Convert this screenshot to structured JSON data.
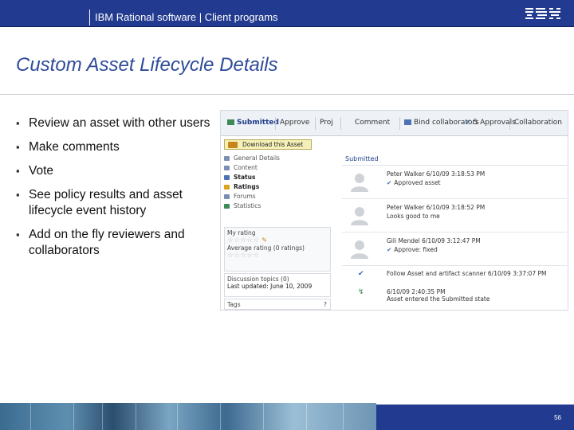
{
  "header": {
    "title": "IBM Rational software  |  Client programs",
    "logo_text": "IBM"
  },
  "page_title": "Custom Asset Lifecycle Details",
  "bullets": [
    "Review an asset with other users",
    "Make comments",
    "Vote",
    "See policy results and asset lifecycle event history",
    "Add on the fly reviewers and collaborators"
  ],
  "screenshot": {
    "tabs": [
      {
        "label": "Submitted",
        "active": true
      },
      {
        "label": "Approve",
        "active": false
      },
      {
        "label": "Proj",
        "active": false
      },
      {
        "label": "Comment",
        "active": false
      },
      {
        "label": "Bind collaborators",
        "active": false
      },
      {
        "label": "5 Approvals",
        "active": false
      },
      {
        "label": "Collaboration",
        "active": false
      }
    ],
    "download_label": "Download this Asset",
    "nav": [
      {
        "label": "General Details",
        "bold": false,
        "color": "#7b8fb5"
      },
      {
        "label": "Content",
        "bold": false,
        "color": "#7b8fb5"
      },
      {
        "label": "Status",
        "bold": true,
        "color": "#4a72b5"
      },
      {
        "label": "Ratings",
        "bold": true,
        "color": "#d9a21b"
      },
      {
        "label": "Forums",
        "bold": false,
        "color": "#7b8fb5"
      },
      {
        "label": "Statistics",
        "bold": false,
        "color": "#3d8a57"
      }
    ],
    "my_rating_label": "My rating",
    "my_rating_stars": "☆☆☆☆☆",
    "avg_rating_label": "Average rating (0 ratings)",
    "avg_rating_stars": "☆☆☆☆☆",
    "discussion_label": "Discussion topics (0)",
    "last_updated_label": "Last updated: June 10, 2009",
    "tags_label": "Tags",
    "tags_count": "?",
    "submitted_heading": "Submitted",
    "entries": [
      {
        "name_line": "Peter Walker 6/10/09 3:18:53 PM",
        "detail": "Approved asset",
        "checked": true
      },
      {
        "name_line": "Peter Walker 6/10/09 3:18:52 PM",
        "detail": "Looks good to me",
        "checked": false
      },
      {
        "name_line": "Gili Mendel 6/10/09 3:12:47 PM",
        "detail": "Approve: fixed",
        "checked": true
      }
    ],
    "system_rows": [
      {
        "mark": "✔",
        "line1": "Follow Asset and artifact scanner 6/10/09 3:37:07 PM",
        "line2": ""
      },
      {
        "mark": "↯",
        "line1": "6/10/09 2:40:35 PM",
        "line2": "Asset entered the Submitted state"
      }
    ]
  },
  "footer": {
    "page_number": "56"
  }
}
